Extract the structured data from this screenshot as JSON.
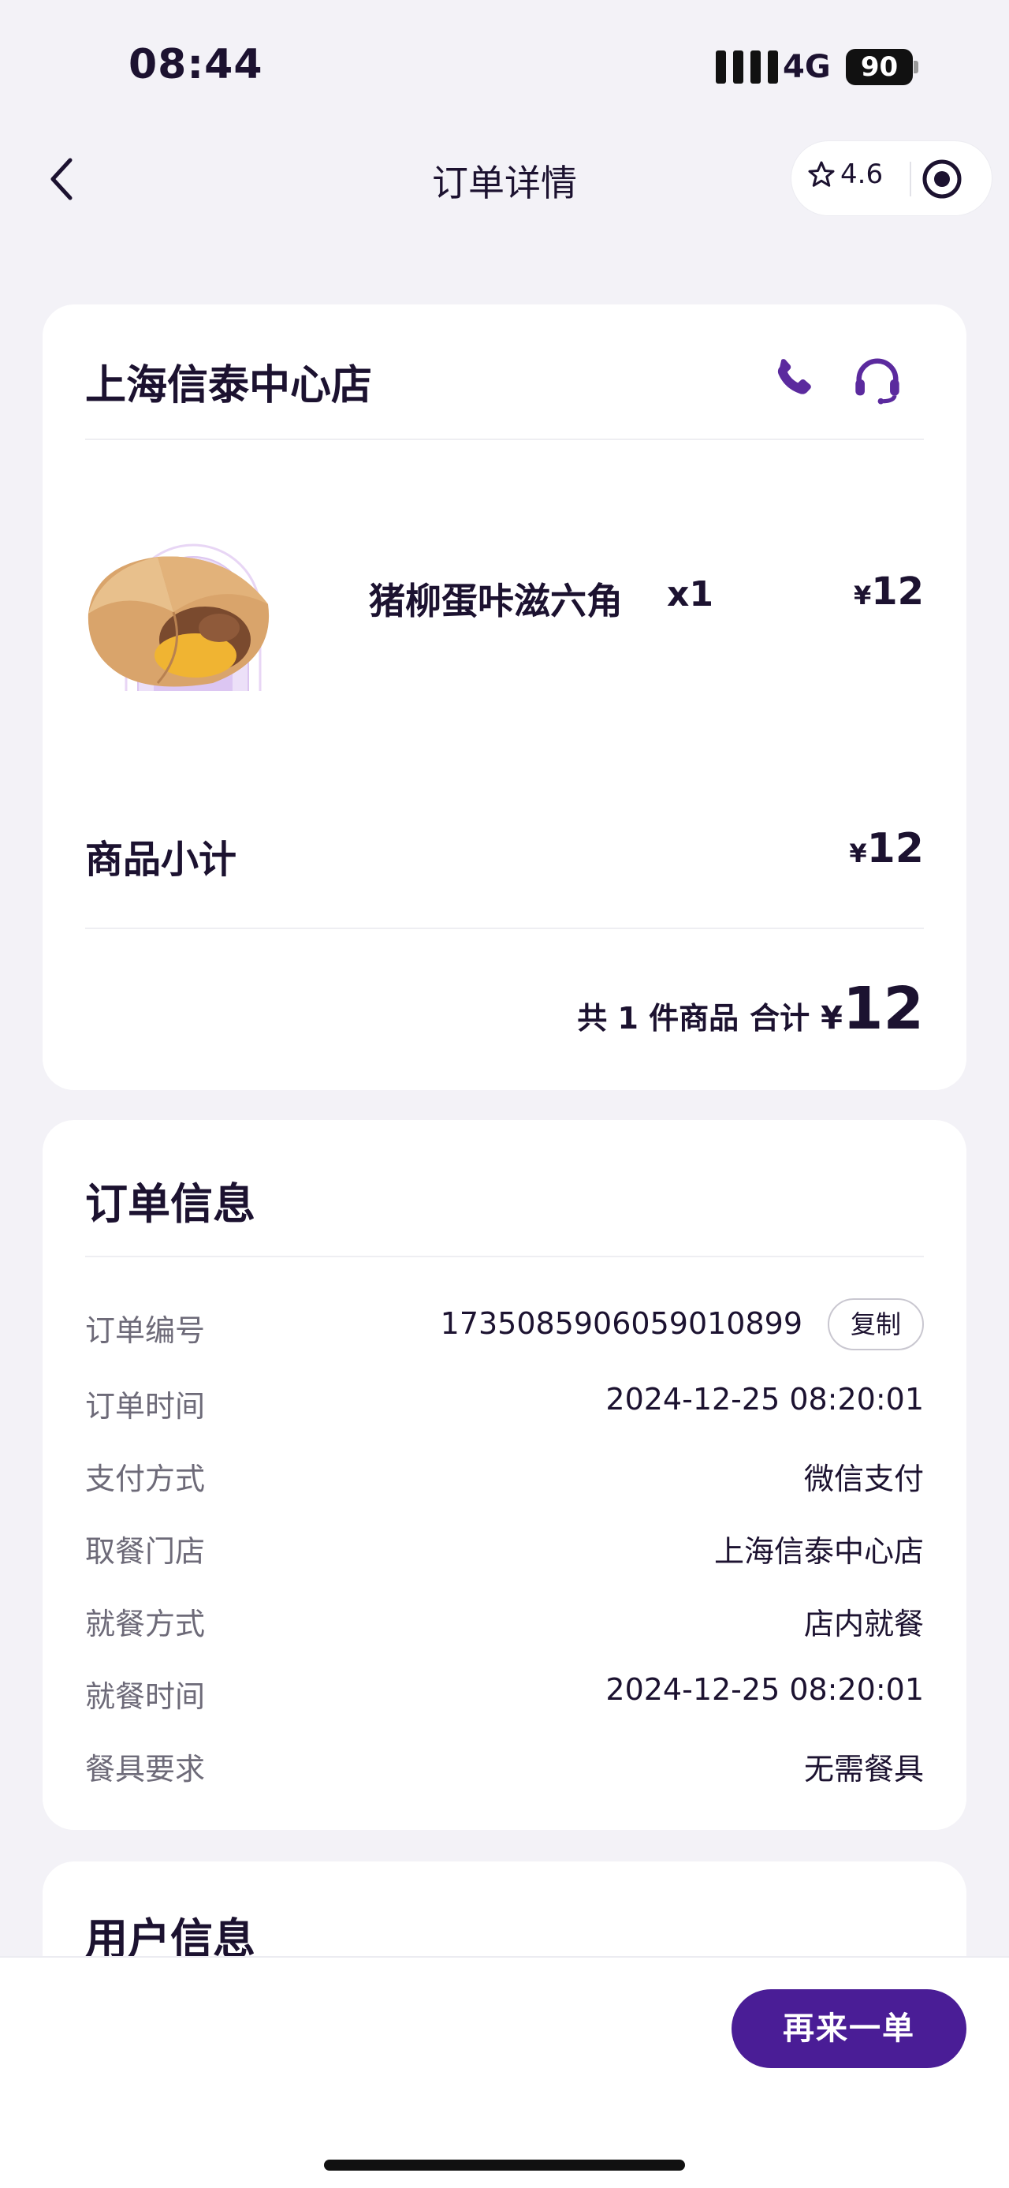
{
  "status_bar": {
    "time": "08:44",
    "network": "4G",
    "battery": "90"
  },
  "nav": {
    "title": "订单详情",
    "rating": "4.6"
  },
  "store": {
    "name": "上海信泰中心店",
    "item": {
      "name": "猪柳蛋咔滋六角",
      "qty": "x1",
      "currency": "¥",
      "price": "12"
    },
    "subtotal_label": "商品小计",
    "subtotal_currency": "¥",
    "subtotal_value": "12",
    "summary_count": "共 1 件商品",
    "summary_total_label": "合计",
    "summary_currency": "¥",
    "summary_total": "12"
  },
  "order_info": {
    "title": "订单信息",
    "copy_label": "复制",
    "rows": [
      {
        "label": "订单编号",
        "value": "1735085906059010899"
      },
      {
        "label": "订单时间",
        "value": "2024-12-25 08:20:01"
      },
      {
        "label": "支付方式",
        "value": "微信支付"
      },
      {
        "label": "取餐门店",
        "value": "上海信泰中心店"
      },
      {
        "label": "就餐方式",
        "value": "店内就餐"
      },
      {
        "label": "就餐时间",
        "value": "2024-12-25 08:20:01"
      },
      {
        "label": "餐具要求",
        "value": "无需餐具"
      }
    ]
  },
  "user_info": {
    "title": "用户信息"
  },
  "footer": {
    "reorder_label": "再来一单"
  },
  "colors": {
    "accent": "#4a1d96",
    "background": "#f3f2f7",
    "icon": "#5b2a9e"
  }
}
